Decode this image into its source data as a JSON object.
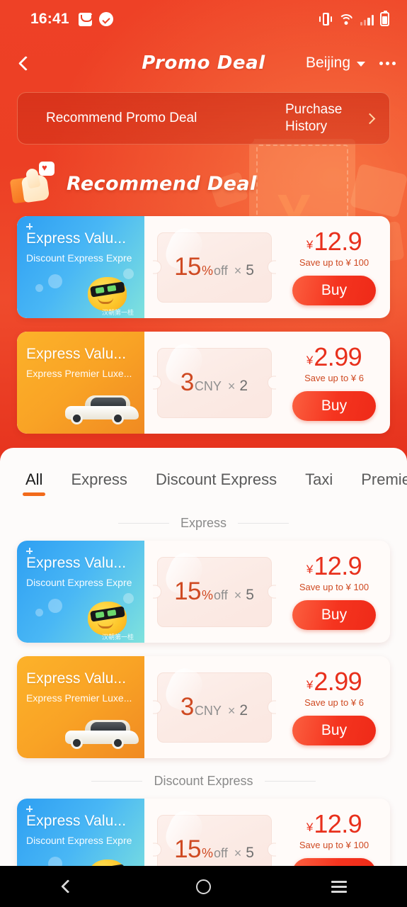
{
  "status_bar": {
    "time": "16:41",
    "icons": [
      "mail-icon",
      "check-circle-icon",
      "vibrate-icon",
      "wifi-icon",
      "signal-icon",
      "battery-icon"
    ]
  },
  "header": {
    "title": "Promo Deal",
    "city": "Beijing",
    "back_icon": "back-chevron-icon",
    "more_icon": "more-options-icon"
  },
  "promo_strip": {
    "label": "Recommend Promo Deal",
    "history_label": "Purchase History",
    "chevron": "chevron-right-icon"
  },
  "recommend": {
    "title": "Recommend Deal",
    "icon": "thumbs-up-icon"
  },
  "tabs": [
    {
      "label": "All",
      "active": true
    },
    {
      "label": "Express",
      "active": false
    },
    {
      "label": "Discount Express",
      "active": false
    },
    {
      "label": "Taxi",
      "active": false
    },
    {
      "label": "Premier",
      "active": false
    }
  ],
  "sections": [
    {
      "label": "Express"
    },
    {
      "label": "Discount Express"
    }
  ],
  "deals": {
    "express_discount": {
      "thumb_title": "Express Valu...",
      "thumb_sub": "Discount Express  Expre",
      "coupon_num": "15",
      "coupon_unit": "%",
      "coupon_unit2": "off",
      "coupon_mult": "×",
      "coupon_qty": "5",
      "price_symbol": "¥",
      "price": "12.9",
      "save_text": "Save up to ¥ 100",
      "buy_label": "Buy",
      "thumb_caption": "汉朝第一桂"
    },
    "express_premier": {
      "thumb_title": "Express Valu...",
      "thumb_sub": "Express  Premier  Luxe...",
      "coupon_num": "3",
      "coupon_unit": "CNY",
      "coupon_mult": "×",
      "coupon_qty": "2",
      "price_symbol": "¥",
      "price": "2.99",
      "save_text": "Save up to ¥ 6",
      "buy_label": "Buy"
    }
  },
  "nav_bar": {
    "back": "nav-back-icon",
    "home": "nav-home-icon",
    "recents": "nav-recents-icon"
  },
  "colors": {
    "brand_red": "#ee4126",
    "accent_orange": "#f26a1b",
    "price_red": "#e8301c",
    "coupon_text": "#cf4a22"
  }
}
